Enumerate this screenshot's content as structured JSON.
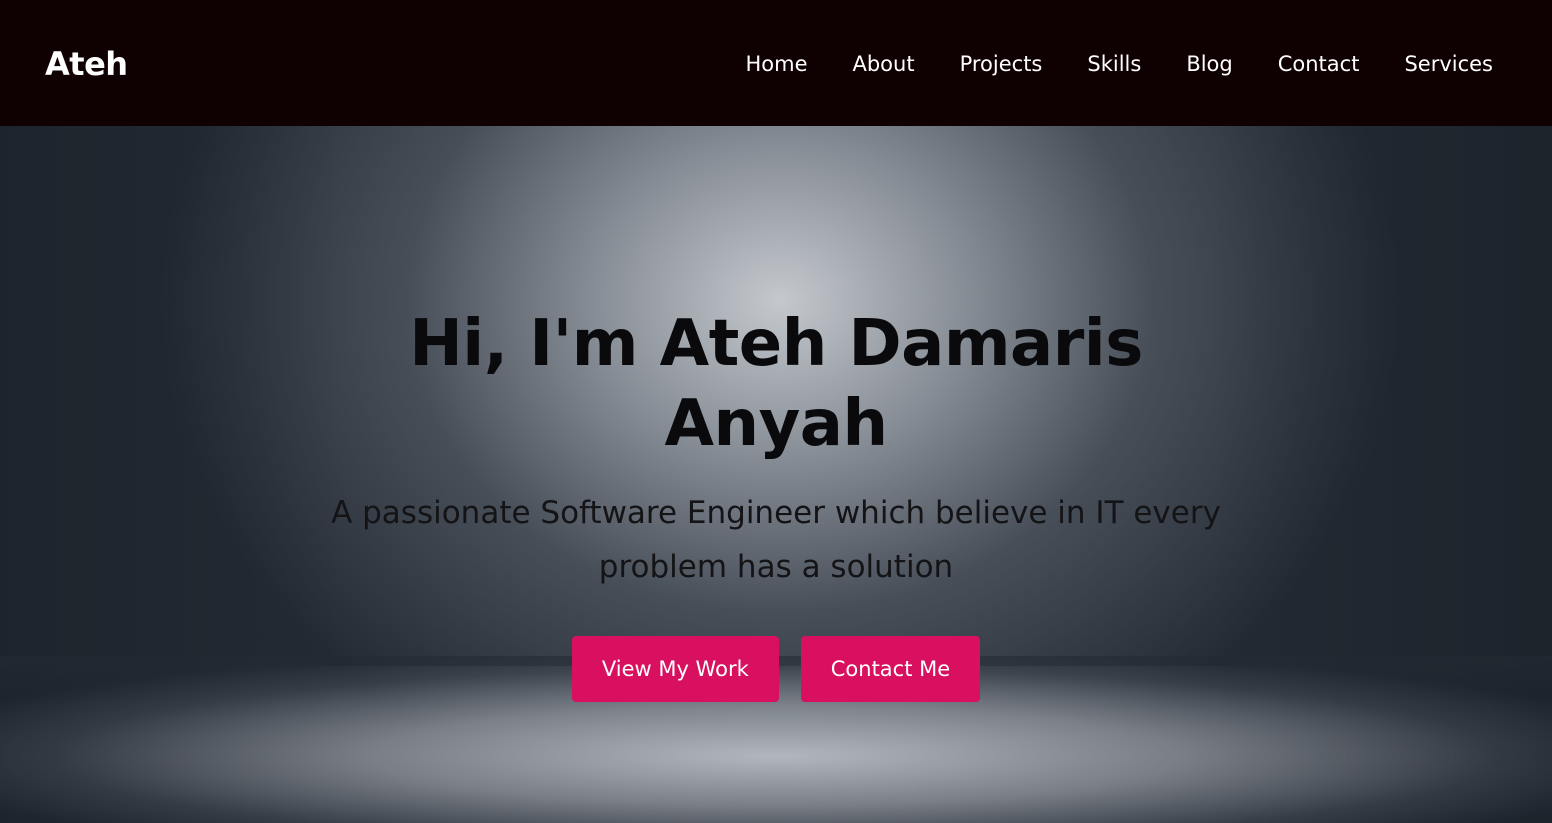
{
  "navbar": {
    "brand": "Ateh",
    "links": [
      {
        "label": "Home"
      },
      {
        "label": "About"
      },
      {
        "label": "Projects"
      },
      {
        "label": "Skills"
      },
      {
        "label": "Blog"
      },
      {
        "label": "Contact"
      },
      {
        "label": "Services"
      }
    ]
  },
  "hero": {
    "title": "Hi, I'm Ateh Damaris Anyah",
    "subtitle": "A passionate Software Engineer which believe in IT every problem has a solution",
    "buttons": {
      "primary": "View My Work",
      "secondary": "Contact Me"
    }
  },
  "colors": {
    "navbar_bg": "#0f0002",
    "button_bg": "#d90f5f",
    "nav_text": "#ffffff",
    "hero_text": "#0a0a0c"
  }
}
